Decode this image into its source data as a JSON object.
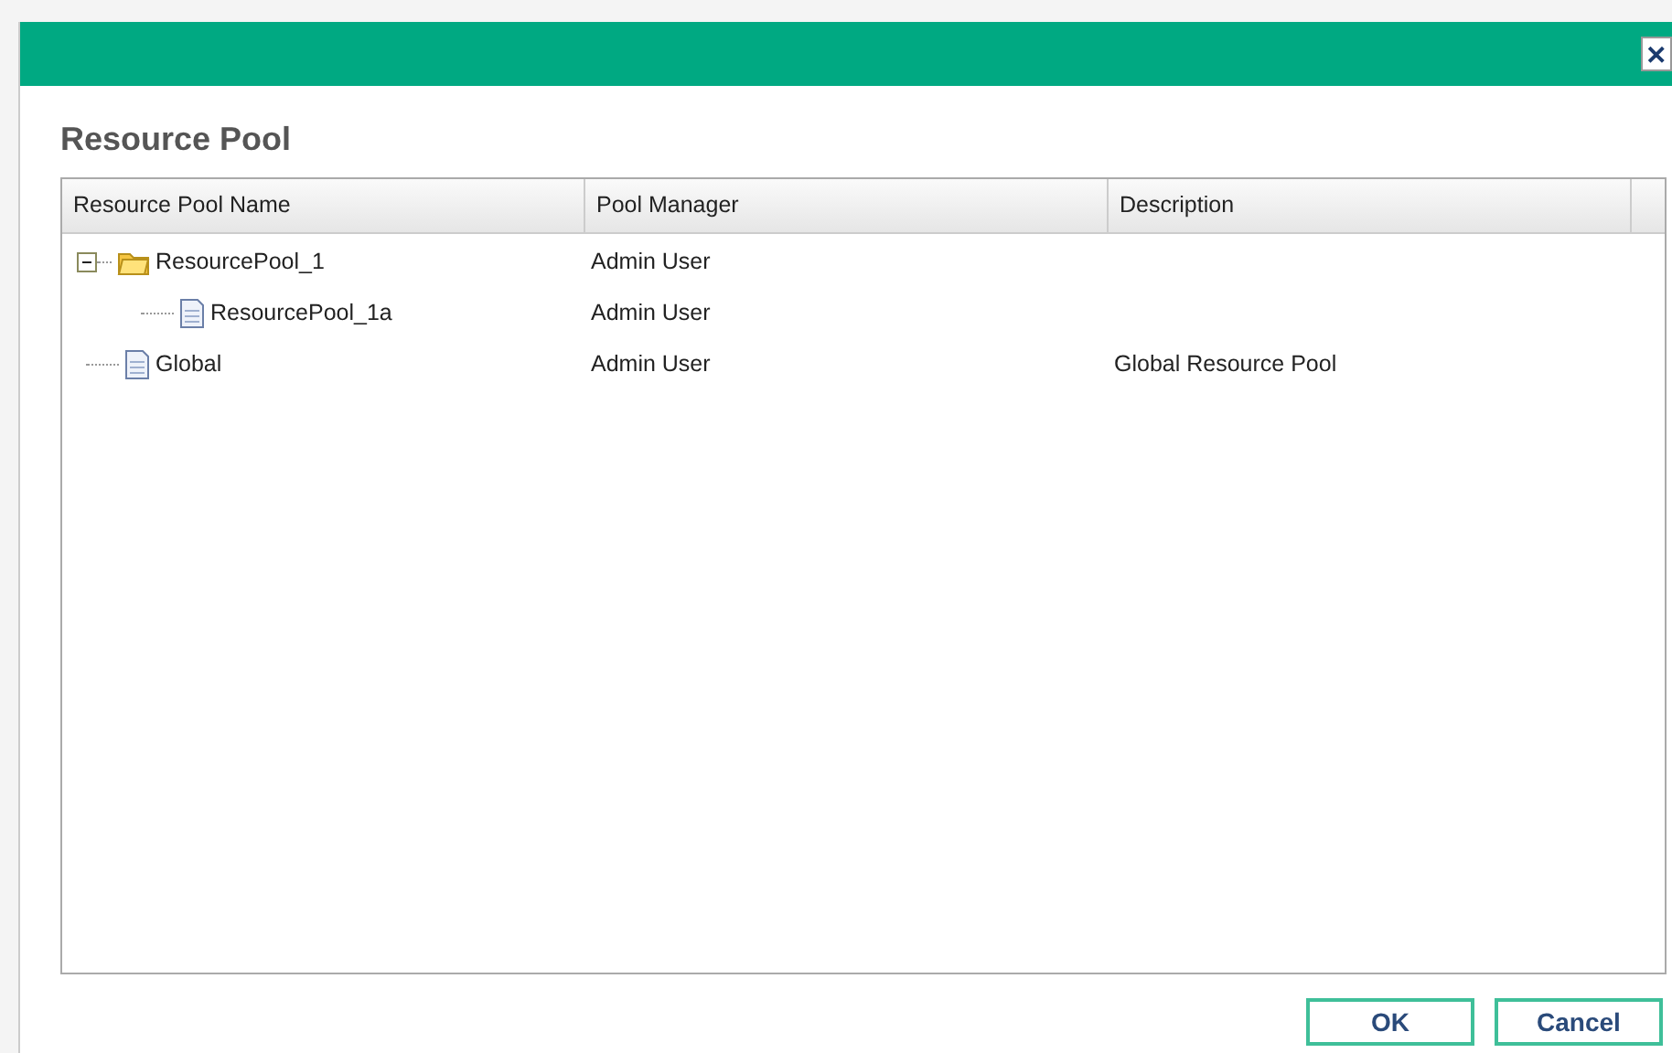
{
  "dialog": {
    "close": "✕",
    "title": "Resource Pool"
  },
  "table": {
    "columns": [
      "Resource Pool Name",
      "Pool Manager",
      "Description"
    ],
    "rows": [
      {
        "name": "ResourcePool_1",
        "kind": "folder",
        "expanded": true,
        "manager": "Admin User",
        "children": [
          {
            "name": "ResourcePool_1a",
            "kind": "document",
            "manager": "Admin User"
          }
        ]
      },
      {
        "name": "Global",
        "kind": "document",
        "manager": "Admin User",
        "description": "Global Resource Pool"
      }
    ]
  },
  "buttons": [
    "OK",
    "Cancel"
  ]
}
